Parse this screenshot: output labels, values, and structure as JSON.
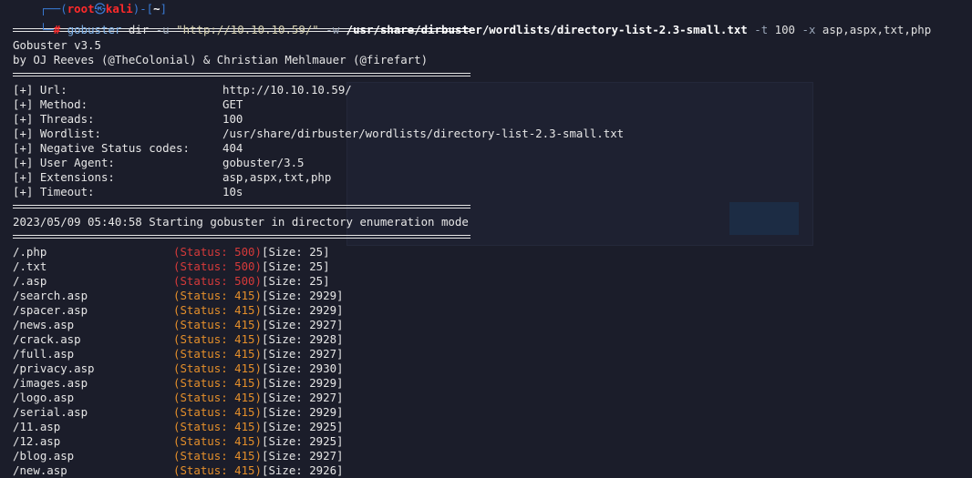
{
  "prompt": {
    "top_left": "┌──(",
    "user": "root",
    "at": "㉿",
    "host": "kali",
    "mid": ")-[",
    "dir": "~",
    "end": "]",
    "bottom_left": "└─",
    "hash": "#"
  },
  "command": {
    "program": "gobuster",
    "sub": "dir",
    "flag_u": "-u",
    "url": "\"http://10.10.10.59/\"",
    "flag_w": "-w",
    "wordlist": "/usr/share/dirbuster/wordlists/directory-list-2.3-small.txt",
    "flag_t": "-t",
    "threads": "100",
    "flag_x": "-x",
    "ext": "asp,aspx,txt,php"
  },
  "banner": {
    "title": "Gobuster v3.5",
    "authors": "by OJ Reeves (@TheColonial) & Christian Mehlmauer (@firefart)"
  },
  "config": [
    {
      "key": "[+] Url:",
      "value": "http://10.10.10.59/"
    },
    {
      "key": "[+] Method:",
      "value": "GET"
    },
    {
      "key": "[+] Threads:",
      "value": "100"
    },
    {
      "key": "[+] Wordlist:",
      "value": "/usr/share/dirbuster/wordlists/directory-list-2.3-small.txt"
    },
    {
      "key": "[+] Negative Status codes:",
      "value": "404"
    },
    {
      "key": "[+] User Agent:",
      "value": "gobuster/3.5"
    },
    {
      "key": "[+] Extensions:",
      "value": "asp,aspx,txt,php"
    },
    {
      "key": "[+] Timeout:",
      "value": "10s"
    }
  ],
  "start_msg": "2023/05/09 05:40:58 Starting gobuster in directory enumeration mode",
  "results": [
    {
      "path": "/.php",
      "status": "(Status: 500)",
      "size": "[Size: 25]",
      "code": "500"
    },
    {
      "path": "/.txt",
      "status": "(Status: 500)",
      "size": "[Size: 25]",
      "code": "500"
    },
    {
      "path": "/.asp",
      "status": "(Status: 500)",
      "size": "[Size: 25]",
      "code": "500"
    },
    {
      "path": "/search.asp",
      "status": "(Status: 415)",
      "size": "[Size: 2929]",
      "code": "415"
    },
    {
      "path": "/spacer.asp",
      "status": "(Status: 415)",
      "size": "[Size: 2929]",
      "code": "415"
    },
    {
      "path": "/news.asp",
      "status": "(Status: 415)",
      "size": "[Size: 2927]",
      "code": "415"
    },
    {
      "path": "/crack.asp",
      "status": "(Status: 415)",
      "size": "[Size: 2928]",
      "code": "415"
    },
    {
      "path": "/full.asp",
      "status": "(Status: 415)",
      "size": "[Size: 2927]",
      "code": "415"
    },
    {
      "path": "/privacy.asp",
      "status": "(Status: 415)",
      "size": "[Size: 2930]",
      "code": "415"
    },
    {
      "path": "/images.asp",
      "status": "(Status: 415)",
      "size": "[Size: 2929]",
      "code": "415"
    },
    {
      "path": "/logo.asp",
      "status": "(Status: 415)",
      "size": "[Size: 2927]",
      "code": "415"
    },
    {
      "path": "/serial.asp",
      "status": "(Status: 415)",
      "size": "[Size: 2929]",
      "code": "415"
    },
    {
      "path": "/11.asp",
      "status": "(Status: 415)",
      "size": "[Size: 2925]",
      "code": "415"
    },
    {
      "path": "/12.asp",
      "status": "(Status: 415)",
      "size": "[Size: 2925]",
      "code": "415"
    },
    {
      "path": "/blog.asp",
      "status": "(Status: 415)",
      "size": "[Size: 2927]",
      "code": "415"
    },
    {
      "path": "/new.asp",
      "status": "(Status: 415)",
      "size": "[Size: 2926]",
      "code": "415"
    }
  ],
  "colors": {
    "background": "#1b1d2a",
    "status_500": "#d63a3a",
    "status_415": "#e58f2a",
    "prompt_blue": "#3a7bd5",
    "prompt_red": "#ff2a2a"
  }
}
